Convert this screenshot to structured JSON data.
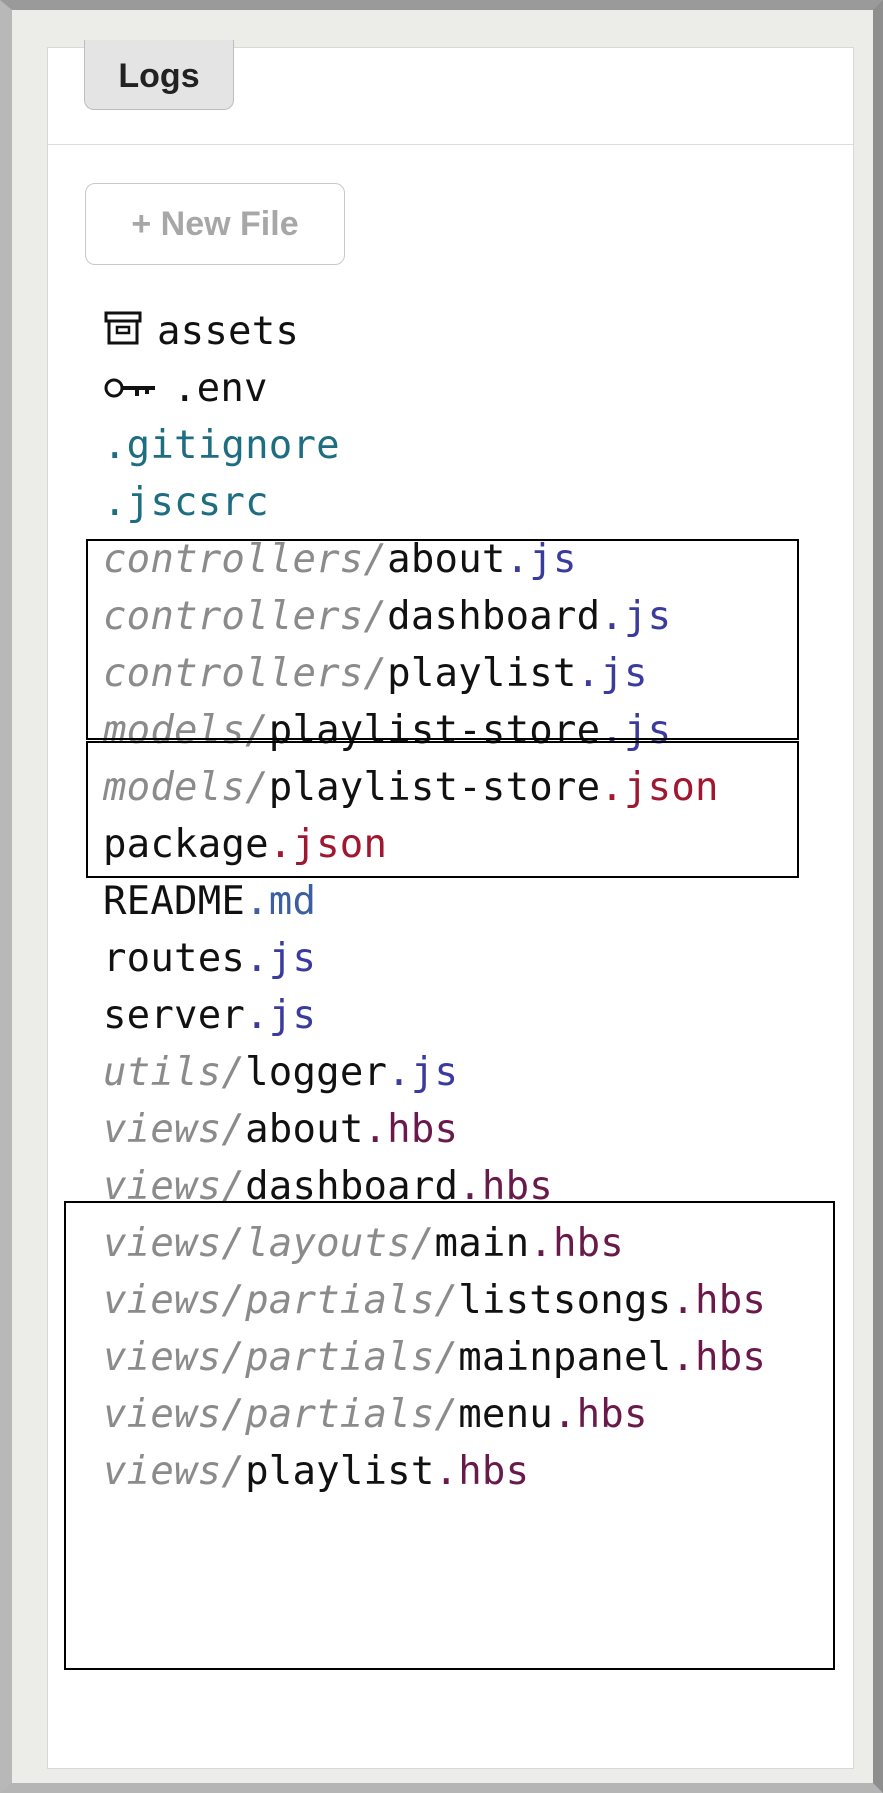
{
  "tab": {
    "label": "Logs"
  },
  "toolbar": {
    "new_file_label": "+ New File"
  },
  "files": [
    {
      "icon": "folder-icon",
      "dir": "",
      "name": "assets",
      "ext": ""
    },
    {
      "icon": "key-icon",
      "dir": "",
      "name": ".env",
      "ext": ""
    },
    {
      "dir": "",
      "name": ".gitignore",
      "ext": ""
    },
    {
      "dir": "",
      "name": ".jscsrc",
      "ext": ""
    },
    {
      "dir": "controllers/",
      "name": "about",
      "ext": ".js"
    },
    {
      "dir": "controllers/",
      "name": "dashboard",
      "ext": ".js"
    },
    {
      "dir": "controllers/",
      "name": "playlist",
      "ext": ".js"
    },
    {
      "dir": "models/",
      "name": "playlist-store",
      "ext": ".js"
    },
    {
      "dir": "models/",
      "name": "playlist-store",
      "ext": ".json"
    },
    {
      "dir": "",
      "name": "package",
      "ext": ".json"
    },
    {
      "dir": "",
      "name": "README",
      "ext": ".md"
    },
    {
      "dir": "",
      "name": "routes",
      "ext": ".js"
    },
    {
      "dir": "",
      "name": "server",
      "ext": ".js"
    },
    {
      "dir": "utils/",
      "name": "logger",
      "ext": ".js"
    },
    {
      "dir": "views/",
      "name": "about",
      "ext": ".hbs"
    },
    {
      "dir": "views/",
      "name": "dashboard",
      "ext": ".hbs"
    },
    {
      "dir": "views/layouts/",
      "name": "main",
      "ext": ".hbs"
    },
    {
      "dir": "views/partials/",
      "name": "listsongs",
      "ext": ".hbs"
    },
    {
      "dir": "views/partials/",
      "name": "mainpanel",
      "ext": ".hbs"
    },
    {
      "dir": "views/partials/",
      "name": "menu",
      "ext": ".hbs"
    },
    {
      "dir": "views/",
      "name": "playlist",
      "ext": ".hbs"
    }
  ],
  "colors": {
    "js": "#3b3b9e",
    "json": "#a01830",
    "md": "#3b5fa0",
    "hbs": "#6a1a4a",
    "dotfile": "#1e6d80",
    "dir": "#8b8b8b",
    "annotation_box": "#000000"
  }
}
